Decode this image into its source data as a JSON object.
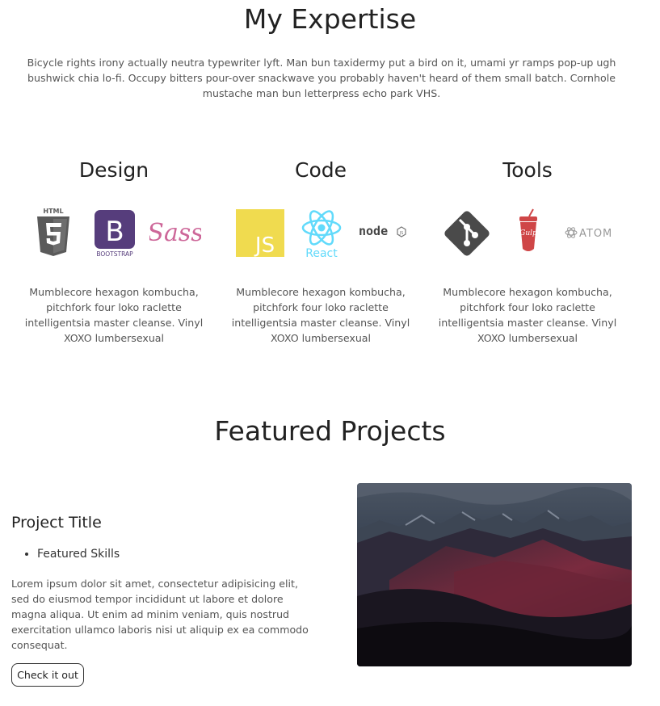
{
  "expertise": {
    "title": "My Expertise",
    "intro": "Bicycle rights irony actually neutra typewriter lyft. Man bun taxidermy put a bird on it, umami yr ramps pop-up ugh bushwick chia lo-fi. Occupy bitters pour-over snackwave you probably haven't heard of them small batch. Cornhole mustache man bun letterpress echo park VHS.",
    "columns": [
      {
        "heading": "Design",
        "icons": [
          {
            "name": "html5-icon",
            "label": "HTML"
          },
          {
            "name": "bootstrap-icon",
            "label": "BOOTSTRAP"
          },
          {
            "name": "sass-icon",
            "label": "Sass"
          }
        ],
        "description": "Mumblecore hexagon kombucha, pitchfork four loko raclette intelligentsia master cleanse. Vinyl XOXO lumbersexual"
      },
      {
        "heading": "Code",
        "icons": [
          {
            "name": "javascript-icon",
            "label": "JS"
          },
          {
            "name": "react-icon",
            "label": "React"
          },
          {
            "name": "nodejs-icon",
            "label": "node"
          }
        ],
        "description": "Mumblecore hexagon kombucha, pitchfork four loko raclette intelligentsia master cleanse. Vinyl XOXO lumbersexual"
      },
      {
        "heading": "Tools",
        "icons": [
          {
            "name": "git-icon",
            "label": ""
          },
          {
            "name": "gulp-icon",
            "label": "Gulp"
          },
          {
            "name": "atom-icon",
            "label": "ATOM"
          }
        ],
        "description": "Mumblecore hexagon kombucha, pitchfork four loko raclette intelligentsia master cleanse. Vinyl XOXO lumbersexual"
      }
    ]
  },
  "projects": {
    "title": "Featured Projects",
    "items": [
      {
        "title": "Project Title",
        "skills": [
          "Featured Skills"
        ],
        "description": "Lorem ipsum dolor sit amet, consectetur adipisicing elit, sed do eiusmod tempor incididunt ut labore et dolore magna aliqua. Ut enim ad minim veniam, quis nostrud exercitation ullamco laboris nisi ut aliquip ex ea commodo consequat.",
        "button_label": "Check it out",
        "image": {
          "name": "mountain-landscape-image"
        }
      }
    ]
  },
  "colors": {
    "text": "#333333",
    "muted": "#555555",
    "html5": "#5a5a5a",
    "bootstrap": "#563d7c",
    "sass": "#cd6799",
    "javascript": "#f0db4f",
    "react": "#61dafb",
    "git": "#4a4a4a",
    "gulp": "#cf4647"
  }
}
